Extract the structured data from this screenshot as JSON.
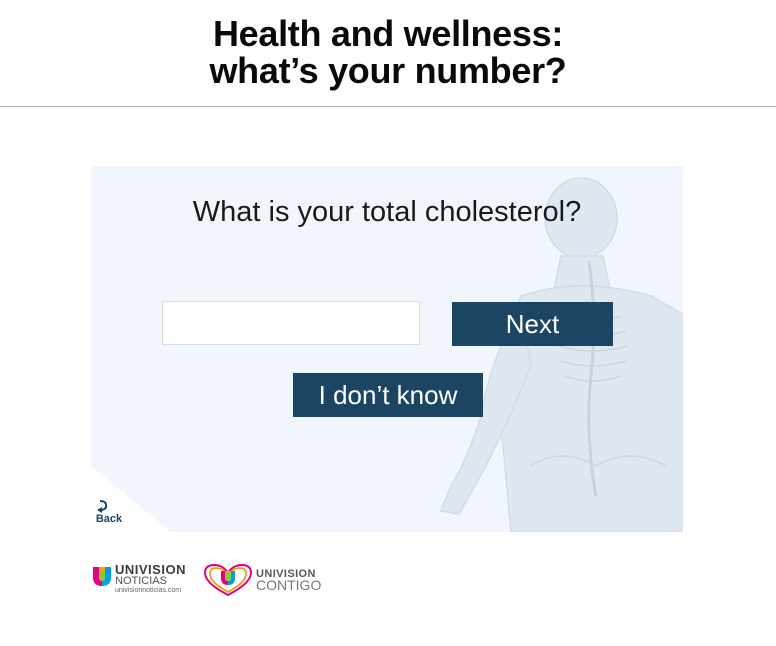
{
  "header": {
    "title_line1": "Health and wellness:",
    "title_line2": "what’s your number?"
  },
  "quiz": {
    "question": "What is your total cholesterol?",
    "answer_value": "",
    "next_label": "Next",
    "dont_know_label": "I don’t know",
    "back_label": "Back"
  },
  "footer": {
    "logo1": {
      "brand": "UNIVISION",
      "sub": "NOTICIAS",
      "url": "univisionnoticias.com"
    },
    "logo2": {
      "brand": "UNIVISION",
      "sub": "CONTIGO"
    }
  },
  "colors": {
    "primary_button": "#1c4563",
    "card_background": "#f0f6fc",
    "header_rule": "#b4b4b4"
  },
  "icons": [
    "back-arrow-icon",
    "anatomy-illustration",
    "univision-logo-icon",
    "heart-logo-icon"
  ]
}
